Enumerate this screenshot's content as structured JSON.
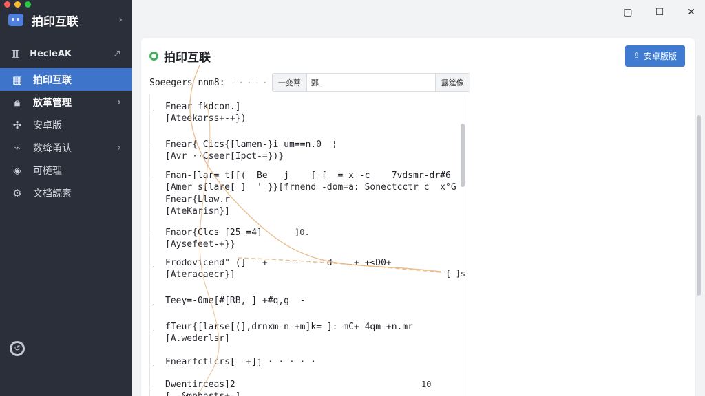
{
  "window": {
    "traffic_colors": [
      "#ff5f57",
      "#febc2e",
      "#28c840"
    ],
    "controls": [
      "minimize-icon",
      "maximize-icon",
      "close-icon"
    ]
  },
  "sidebar": {
    "brand_title": "拍印互联",
    "top_section": {
      "label": "HecleAK"
    },
    "items": [
      {
        "label": "拍印互联",
        "icon": "calendar-icon",
        "active": true
      },
      {
        "label": "放革管理",
        "icon": "lock-icon",
        "has_arrow": true
      },
      {
        "label": "安卓版",
        "icon": "robot-icon"
      },
      {
        "label": "数绛甬认",
        "icon": "signal-icon",
        "has_arrow": true
      },
      {
        "label": "可梿理",
        "icon": "shield-icon"
      },
      {
        "label": "文档読素",
        "icon": "gear-icon"
      }
    ]
  },
  "card": {
    "title": "拍印互联",
    "primary_button": "安卓版版",
    "search": {
      "label": "Soeegers nnm8:",
      "dots": "· · · · ·",
      "left_btn": "一变蒂",
      "input_value": "鄄_",
      "right_btn": "露筵像"
    }
  },
  "code_entries": [
    {
      "line1": "Fnear fkdcon.]",
      "line2": "[Ateekarss+-+})"
    },
    {
      "line1": "Fnear{ Cics{[lamen-}i um==n.0",
      "line2": "[Avr ··Cseer[Ipct-=})}",
      "extra": "¦"
    },
    {
      "line1": "Fnan-[lar= t[[(  Be   j    [ [  = x -c    7vdsmr-dr#6",
      "line2": "[Amer s[lare[ ]  ' }}[frnend -dom=a: Sonectcctr c  x°G"
    },
    {
      "line1": "Fnear{Llaw.r",
      "line2": "[AteKarisn}]"
    },
    {
      "line1": "Fnaor{Clcs [25 =4]",
      "line2": "[Aysefeet-+}}",
      "extra": "]0."
    },
    {
      "line1": "Frodovicend\" (]  -+   ---  -- d   .+ +<D0+",
      "line2": "[Ateracaecr}]",
      "extra": "-{ ]s"
    },
    {
      "line1": "Teey=-0me[#[RB, ] +#q,g  -",
      "line2": ""
    },
    {
      "line1": "fTeur{[larse[(],drnxm-n-+m]k= ]: mC+ 4qm-+n.mr",
      "line2": "[A.wederlsr]"
    },
    {
      "line1": "Fnearfctlcrs[ -+]j · · · · ·",
      "line2": ""
    },
    {
      "line1": "Dwentirceas]2",
      "line2": "[ -&mpbnsts+-]",
      "extra": "10"
    }
  ]
}
